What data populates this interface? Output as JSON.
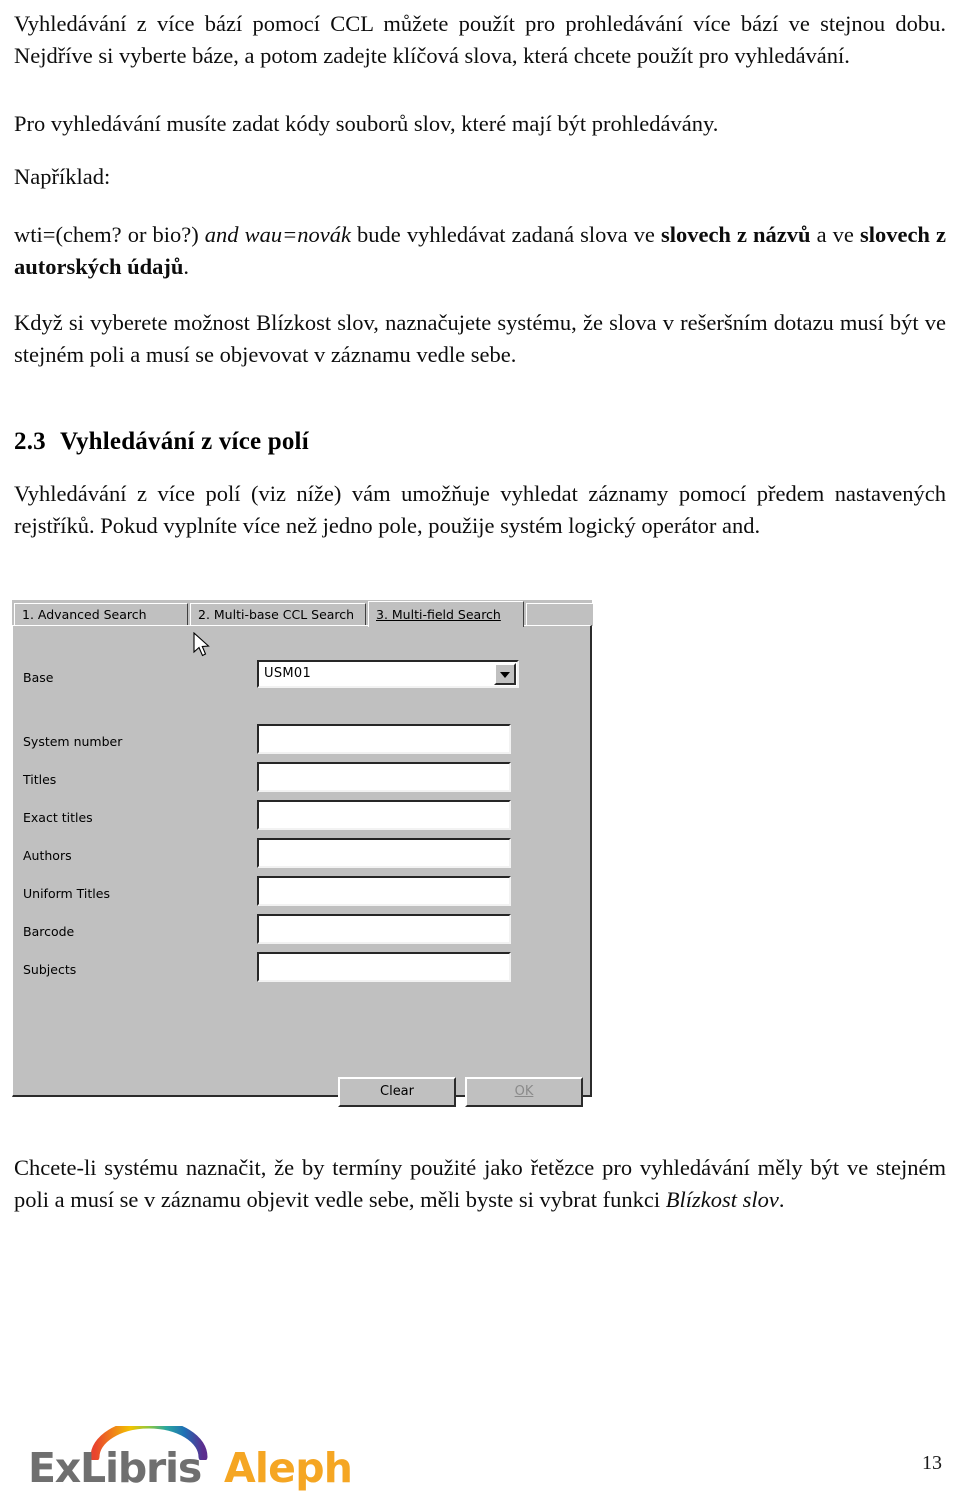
{
  "document": {
    "paragraphs": [
      {
        "id": "p1",
        "text": "Vyhledávání z více bází pomocí CCL můžete použít pro prohledávání více bází ve stejnou dobu. Nejdříve si vyberte báze, a potom zadejte klíčová slova, která chcete použít pro vyhledávání."
      },
      {
        "id": "p2",
        "text": "Pro vyhledávání musíte zadat kódy souborů slov, které mají být prohledávány."
      },
      {
        "id": "p3",
        "text": "Například:"
      },
      {
        "id": "p5",
        "text": "Když si vyberete možnost Blízkost slov, naznačujete systému, že slova v rešeršním dotazu musí být ve stejném poli a musí se objevovat v záznamu vedle sebe."
      },
      {
        "id": "p7",
        "text": "Vyhledávání z více polí (viz níže) vám umožňuje vyhledat záznamy pomocí předem nastavených rejstříků. Pokud vyplníte více než jedno pole, použije systém logický operátor and."
      }
    ],
    "example_line": {
      "plain_1": "wti=(chem? or bio?) ",
      "italic_1": "and wau=novák",
      "plain_2": " bude vyhledávat zadaná slova ve ",
      "bold_1": "slovech z názvů",
      "plain_3": " a ve ",
      "bold_2": "slovech z autorských údajů",
      "plain_4": "."
    },
    "heading": {
      "number": "2.3",
      "title": "Vyhledávání z více polí"
    },
    "closing_paragraph": {
      "plain_1": "Chcete-li systému naznačit, že by termíny použité jako řetězce pro vyhledávání měly být ve stejném poli a musí se v záznamu objevit vedle sebe, měli byste si vybrat funkci ",
      "italic_1": "Blízkost slov",
      "plain_2": "."
    }
  },
  "screenshot": {
    "tabs": [
      {
        "label": "1. Advanced Search",
        "active": false
      },
      {
        "label": "2. Multi-base CCL Search",
        "active": false
      },
      {
        "label": "3. Multi-field Search",
        "active": true
      }
    ],
    "base_field": {
      "label": "Base",
      "value": "USM01"
    },
    "fields": [
      {
        "label": "System number",
        "value": ""
      },
      {
        "label": "Titles",
        "value": ""
      },
      {
        "label": "Exact titles",
        "value": ""
      },
      {
        "label": "Authors",
        "value": ""
      },
      {
        "label": "Uniform Titles",
        "value": ""
      },
      {
        "label": "Barcode",
        "value": ""
      },
      {
        "label": "Subjects",
        "value": ""
      }
    ],
    "buttons": [
      {
        "label": "Clear",
        "enabled": true
      },
      {
        "label": "OK",
        "enabled": false
      }
    ],
    "colors": {
      "face": "#c0c0c0",
      "shadow": "#2b2b2b",
      "highlight": "#ffffff",
      "field": "#ffffff"
    }
  },
  "footer": {
    "brand_primary": "ExLibris",
    "brand_secondary": "Aleph",
    "page_number": "13",
    "colors": {
      "brand_grey": "#6f6f6f",
      "brand_orange": "#f5a623"
    }
  }
}
